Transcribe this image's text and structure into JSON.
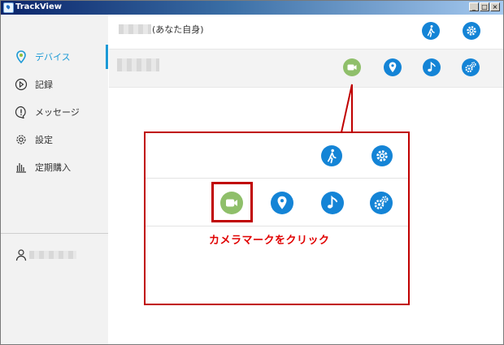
{
  "window": {
    "title": "TrackView"
  },
  "sidebar": {
    "items": [
      {
        "label": "デバイス",
        "icon": "location-pin-icon",
        "active": true
      },
      {
        "label": "記録",
        "icon": "play-circle-icon",
        "active": false
      },
      {
        "label": "メッセージ",
        "icon": "message-icon",
        "active": false
      },
      {
        "label": "設定",
        "icon": "gear-icon",
        "active": false
      },
      {
        "label": "定期購入",
        "icon": "chart-bars-icon",
        "active": false
      }
    ],
    "user_icon": "user-icon"
  },
  "devices": [
    {
      "label": "(あなた自身)",
      "actions": [
        "walk-icon",
        "gear-icon"
      ]
    },
    {
      "label": "",
      "actions": [
        "camera-icon",
        "location-pin-icon",
        "music-note-icon",
        "gears-icon"
      ]
    }
  ],
  "callout": {
    "instruction": "カメラマークをクリック",
    "colors": {
      "border": "#c00000",
      "text": "#e00000"
    }
  },
  "colors": {
    "accent": "#1c9ad6",
    "action_blue": "#1484d6",
    "camera_green": "#8fbf6a",
    "sidebar_bg": "#f2f2f2"
  }
}
